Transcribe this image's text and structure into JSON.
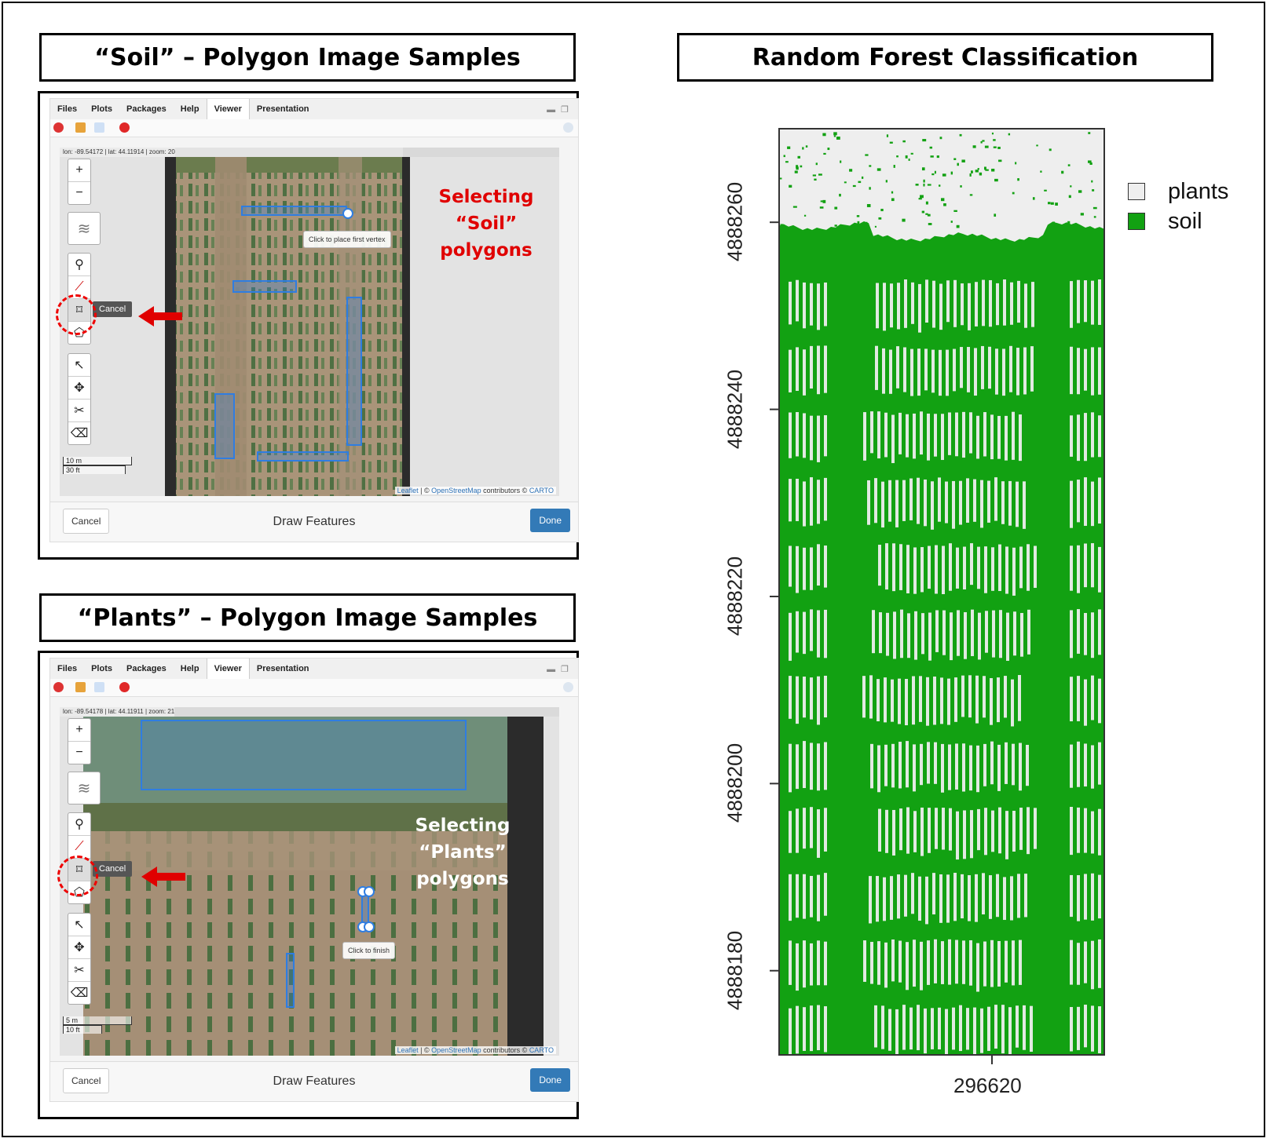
{
  "colors": {
    "plants_class": "#eeeeee",
    "soil_class": "#12a112",
    "polygon": "#2f7de1",
    "red_annotation": "#e00000",
    "done_button": "#337ab7"
  },
  "titles": {
    "soil_panel": "“Soil” – Polygon Image Samples",
    "plants_panel": "“Plants” – Polygon Image Samples",
    "classification": "Random Forest Classification"
  },
  "rstudio": {
    "tabs": [
      "Files",
      "Plots",
      "Packages",
      "Help",
      "Viewer",
      "Presentation"
    ],
    "active_tab": "Viewer",
    "toolbar_icons": [
      "clear-icon",
      "broom-icon",
      "export-icon",
      "stop-icon",
      "refresh-icon"
    ]
  },
  "soil_panel": {
    "coords": "lon: -89.54172 | lat: 44.11914 | zoom: 20",
    "zoom_in": "+",
    "zoom_out": "−",
    "cancel_tip": "Cancel",
    "tooltip": "Click to place first vertex",
    "scale_metric": "10 m",
    "scale_imperial": "30 ft",
    "attrib_leaflet": "Leaflet",
    "attrib_sep": " | © ",
    "attrib_osm": "OpenStreetMap",
    "attrib_contrib": " contributors © ",
    "attrib_carto": "CARTO",
    "btn_cancel": "Cancel",
    "dialog_title": "Draw Features",
    "btn_done": "Done",
    "selection_label": [
      "Selecting",
      "“Soil”",
      "polygons"
    ]
  },
  "plants_panel": {
    "coords": "lon: -89.54178 | lat: 44.11911 | zoom: 21",
    "zoom_in": "+",
    "zoom_out": "−",
    "cancel_tip": "Cancel",
    "tooltip": "Click to finish",
    "scale_metric": "5 m",
    "scale_imperial": "10 ft",
    "attrib_leaflet": "Leaflet",
    "attrib_sep": " | © ",
    "attrib_osm": "OpenStreetMap",
    "attrib_contrib": " contributors © ",
    "attrib_carto": "CARTO",
    "btn_cancel": "Cancel",
    "dialog_title": "Draw Features",
    "btn_done": "Done",
    "selection_label": [
      "Selecting",
      "“Plants”",
      "polygons"
    ]
  },
  "map_tools": [
    "layers-icon",
    "marker-icon",
    "polyline-icon",
    "rectangle-icon",
    "polygon-icon",
    "edit-icon",
    "move-icon",
    "cut-icon",
    "erase-icon"
  ],
  "chart_data": {
    "type": "heatmap",
    "title": "Random Forest Classification",
    "xlabel": "",
    "ylabel": "",
    "x_ticks": [
      296620
    ],
    "y_ticks": [
      4888180,
      4888200,
      4888220,
      4888240,
      4888260
    ],
    "ylim": [
      4888171,
      4888270
    ],
    "legend": [
      {
        "label": "plants",
        "color": "#eeeeee"
      },
      {
        "label": "soil",
        "color": "#12a112"
      }
    ],
    "legend_position": "right"
  }
}
